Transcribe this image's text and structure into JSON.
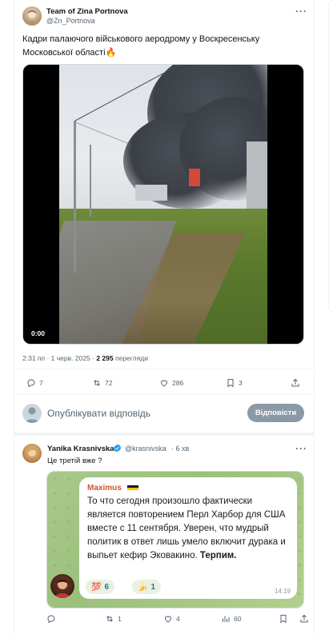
{
  "tweet": {
    "author_name": "Team of Zina Portnova",
    "author_handle": "@Zn_Portnova",
    "text": "Кадри палаючого військового аеродрому  у Воскресенську Московської області",
    "text_emoji": "🔥",
    "video_time": "0:00",
    "meta_time": "2:31 пп · 1 черв. 2025 · ",
    "meta_views_count": "2 295",
    "meta_views_label": " перегляди",
    "stats": {
      "replies": "7",
      "retweets": "72",
      "likes": "286",
      "bookmarks": "3"
    },
    "more_label": "···"
  },
  "reply_composer": {
    "placeholder": "Опублікувати відповідь",
    "button_label": "Відповісти"
  },
  "reply": {
    "author_name": "Yanika Krasnivska",
    "author_handle": "@krasnivska",
    "time": "· 6 хв",
    "text": "Це третій вже ?",
    "more_label": "···",
    "stats": {
      "replies": "",
      "retweets": "1",
      "likes": "4",
      "views": "60"
    },
    "quoted_telegram": {
      "sender": "Maximus",
      "message_part1": "То что сегодня произошло фактически является повторением Перл Харбор для США вместе с 11 сентября. Уверен, что мудрый политик в ответ лишь умело включит дурака и выпьет кефир Эковакино. ",
      "message_bold": "Терпим.",
      "reaction1_emoji": "💯",
      "reaction1_count": "6",
      "reaction2_emoji": "🍌",
      "reaction2_count": "1",
      "time": "14:19"
    }
  },
  "colors": {
    "text_primary": "#0f1419",
    "text_secondary": "#536471",
    "border": "#eff3f4",
    "button_disabled": "#8b98a5",
    "verified": "#1d9bf0"
  }
}
